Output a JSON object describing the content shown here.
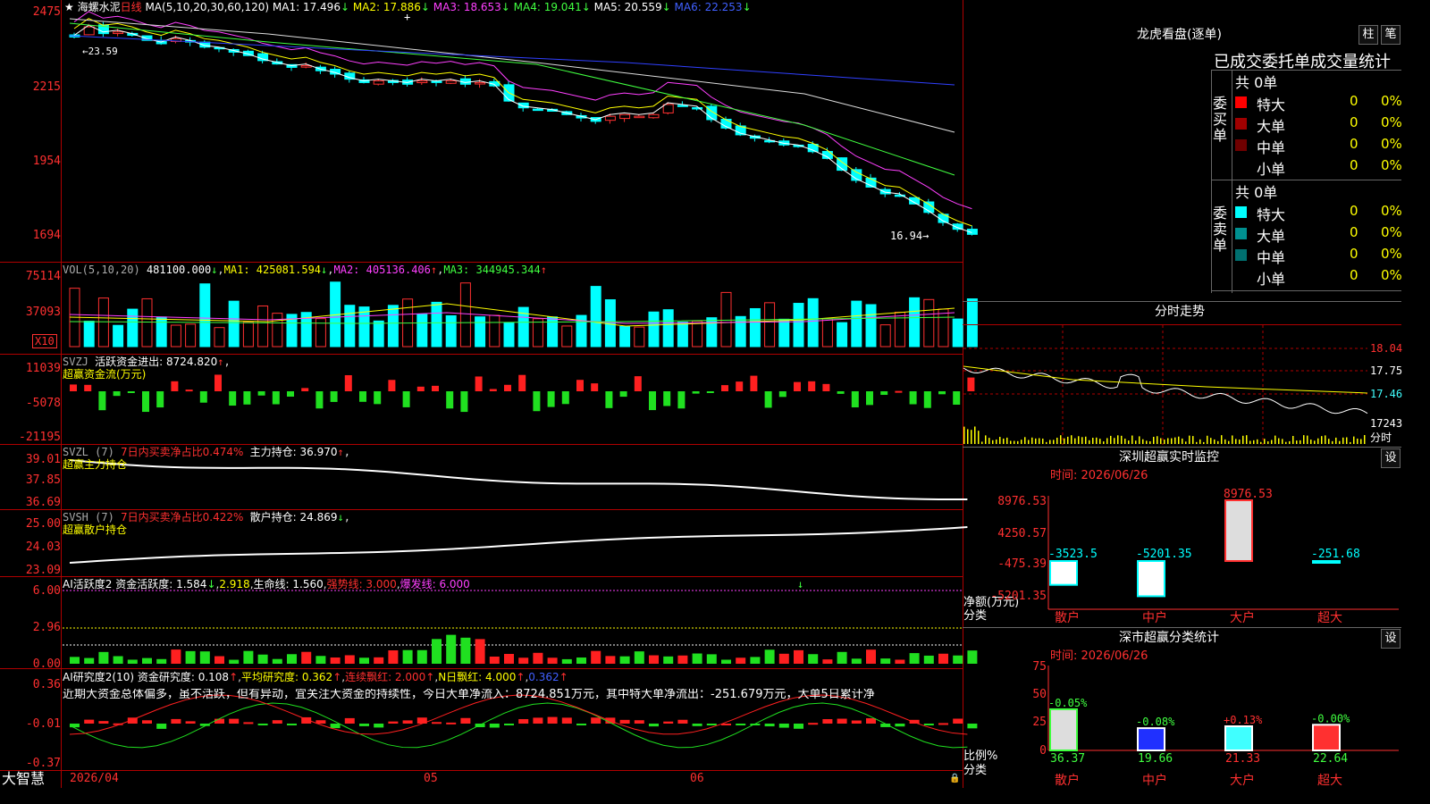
{
  "stock": {
    "name": "海螺水泥",
    "period": "日线",
    "ma_header": "MA(5,10,20,30,60,120)",
    "ma": [
      {
        "label": "MA1: 17.496",
        "arrow": "↓",
        "color": "#ffffff"
      },
      {
        "label": "MA2: 17.886",
        "arrow": "↓",
        "color": "#ffff00"
      },
      {
        "label": "MA3: 18.653",
        "arrow": "↓",
        "color": "#ff40ff"
      },
      {
        "label": "MA4: 19.041",
        "arrow": "↓",
        "color": "#40ff40"
      },
      {
        "label": "MA5: 20.559",
        "arrow": "↓",
        "color": "#ffffff"
      },
      {
        "label": "MA6: 22.253",
        "arrow": "↓",
        "color": "#4060ff"
      }
    ],
    "high_marker": "←23.59",
    "low_marker": "16.94→",
    "price_axis": [
      "2475",
      "2215",
      "1954",
      "1694"
    ]
  },
  "vol": {
    "header": "VOL(5,10,20)",
    "value": "481100.000",
    "ma1": "MA1: 425081.594",
    "ma2": "MA2: 405136.406",
    "ma3": "MA3: 344945.344",
    "axis": [
      "75114",
      "37093"
    ],
    "unit": "X10"
  },
  "svzj": {
    "header": "SVZJ",
    "label": "活跃资金进出: 8724.820",
    "arrow": "↑",
    "sub": "超赢资金流(万元)",
    "axis": [
      "11039",
      "-5078",
      "-21195"
    ]
  },
  "svzl": {
    "header": "SVZL (7)",
    "label": "7日内买卖净占比0.474%",
    "label2": "主力持仓: 36.970",
    "arrow": "↑",
    "sub": "超赢主力持仓",
    "axis": [
      "39.01",
      "37.85",
      "36.69"
    ]
  },
  "svsh": {
    "header": "SVSH (7)",
    "label": "7日内买卖净占比0.422%",
    "label2": "散户持仓: 24.869",
    "arrow": "↓",
    "sub": "超赢散户持仓",
    "axis": [
      "25.00",
      "24.03",
      "23.09"
    ]
  },
  "ai1": {
    "header": "AI活跃度2",
    "l1": "资金活跃度: 1.584",
    "l2": "2.918",
    "l3": "生命线: 1.560",
    "l4": "强势线: 3.000",
    "l5": "爆发线: 6.000",
    "axis": [
      "6.00",
      "2.96",
      "0.00"
    ]
  },
  "ai2": {
    "header": "AI研究度2(10)",
    "l1": "资金研究度: 0.108",
    "l2": "平均研究度: 0.362",
    "l3": "连续飘红: 2.000",
    "l4": "N日飘红: 4.000",
    "l5": "0.362",
    "axis": [
      "0.36",
      "-0.01",
      "-0.37"
    ],
    "commentary": "近期大资金总体偏多，虽不活跃，但有异动，宜关注大资金的持续性，今日大单净流入：8724.851万元，其中特大单净流出：-251.679万元，大单5日累计净"
  },
  "dates": [
    "2026/04",
    "05",
    "06"
  ],
  "brand": "大智慧",
  "right": {
    "lhb_title": "龙虎看盘(逐单)",
    "btn1": "柱",
    "btn2": "笔",
    "tabs": "已成交委托单成交量统计",
    "buy": {
      "side": "委买单",
      "count": "共 0单",
      "rows": [
        {
          "name": "特大",
          "v": "0",
          "p": "0%",
          "c": "#ff0000"
        },
        {
          "name": "大单",
          "v": "0",
          "p": "0%",
          "c": "#a00000"
        },
        {
          "name": "中单",
          "v": "0",
          "p": "0%",
          "c": "#700000"
        },
        {
          "name": "小单",
          "v": "0",
          "p": "0%",
          "c": ""
        }
      ]
    },
    "sell": {
      "side": "委卖单",
      "count": "共 0单",
      "rows": [
        {
          "name": "特大",
          "v": "0",
          "p": "0%",
          "c": "#00ffff"
        },
        {
          "name": "大单",
          "v": "0",
          "p": "0%",
          "c": "#009090"
        },
        {
          "name": "中单",
          "v": "0",
          "p": "0%",
          "c": "#007070"
        },
        {
          "name": "小单",
          "v": "0",
          "p": "0%",
          "c": ""
        }
      ]
    },
    "intraday": {
      "title": "分时走势",
      "axis": [
        "18.04",
        "17.75",
        "17.46",
        "17243"
      ],
      "unit": "分时"
    },
    "monitor": {
      "title": "深圳超赢实时监控",
      "btn": "设",
      "time": "时间: 2026/06/26",
      "axis": [
        "8976.53",
        "4250.57",
        "-475.39",
        "-5201.35"
      ],
      "ylabel": "净额(万元)",
      "xlabel": "分类",
      "bars": [
        {
          "name": "散户",
          "v": "-3523.5"
        },
        {
          "name": "中户",
          "v": "-5201.35"
        },
        {
          "name": "大户",
          "v": "8976.53"
        },
        {
          "name": "超大",
          "v": "-251.68"
        }
      ]
    },
    "stats": {
      "title": "深市超赢分类统计",
      "btn": "设",
      "time": "时间: 2026/06/26",
      "axis": [
        "75",
        "50",
        "25",
        "0"
      ],
      "ylabel": "比例%",
      "xlabel": "分类",
      "bars": [
        {
          "name": "散户",
          "top": "-0.05%",
          "val": "36.37"
        },
        {
          "name": "中户",
          "top": "-0.08%",
          "val": "19.66"
        },
        {
          "name": "大户",
          "top": "+0.13%",
          "val": "21.33"
        },
        {
          "name": "超大",
          "top": "-0.00%",
          "val": "22.64"
        }
      ]
    }
  },
  "chart_data": [
    {
      "type": "candlestick",
      "title": "海螺水泥 日线",
      "ylim": [
        16.94,
        23.59
      ],
      "close": [
        22.9,
        23.2,
        23.0,
        23.05,
        22.95,
        22.8,
        22.7,
        22.85,
        22.75,
        22.6,
        22.55,
        22.45,
        22.35,
        22.2,
        22.1,
        22.0,
        22.05,
        21.9,
        21.8,
        21.65,
        21.55,
        21.6,
        21.55,
        21.5,
        21.6,
        21.55,
        21.6,
        21.5,
        21.55,
        21.45,
        21.0,
        20.8,
        20.75,
        20.7,
        20.6,
        20.5,
        20.4,
        20.55,
        20.6,
        20.55,
        20.6,
        20.9,
        20.85,
        20.8,
        20.45,
        20.2,
        20.0,
        19.9,
        19.8,
        19.7,
        19.65,
        19.5,
        19.3,
        18.95,
        18.65,
        18.45,
        18.25,
        18.2,
        17.95,
        17.7,
        17.4,
        17.2,
        17.05
      ]
    },
    {
      "type": "bar",
      "title": "VOL(5,10,20)",
      "ylim": [
        0,
        75114
      ]
    },
    {
      "type": "bar",
      "title": "SVZJ",
      "ylim": [
        -21195,
        11039
      ]
    },
    {
      "type": "line",
      "title": "SVZL",
      "ylim": [
        36.69,
        39.01
      ]
    },
    {
      "type": "line",
      "title": "SVSH",
      "ylim": [
        23.09,
        25.0
      ]
    },
    {
      "type": "bar",
      "title": "AI活跃度2",
      "ylim": [
        0,
        6
      ]
    },
    {
      "type": "bar",
      "title": "AI研究度2(10)",
      "ylim": [
        -0.37,
        0.36
      ]
    },
    {
      "type": "bar",
      "title": "深圳超赢实时监控",
      "categories": [
        "散户",
        "中户",
        "大户",
        "超大"
      ],
      "values": [
        -3523.5,
        -5201.35,
        8976.53,
        -251.68
      ],
      "ylim": [
        -5201.35,
        8976.53
      ]
    },
    {
      "type": "bar",
      "title": "深市超赢分类统计",
      "categories": [
        "散户",
        "中户",
        "大户",
        "超大"
      ],
      "values": [
        36.37,
        19.66,
        21.33,
        22.64
      ],
      "ylim": [
        0,
        75
      ]
    }
  ]
}
